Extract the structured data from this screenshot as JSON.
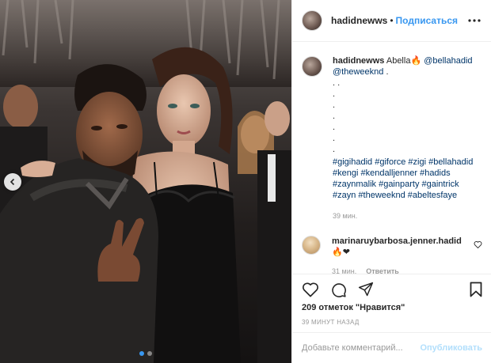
{
  "post": {
    "username": "hadidnewws",
    "separator": "•",
    "follow_label": "Подписаться",
    "caption": {
      "username": "hadidnewws",
      "text": "Abella",
      "emoji": "🔥",
      "mention_1": "@bellahadid",
      "mention_2": "@theweeknd",
      "period": ".",
      "dot_lines": [
        ". .",
        ".",
        ".",
        ".",
        ".",
        ".",
        "."
      ],
      "hashtags": "#gigihadid #giforce #zigi #bellahadid #kengi #kendalljenner #hadids #zaynmalik #gainparty #gaintrick #zayn #theweeknd #abeltesfaye",
      "time": "39 мин."
    },
    "comment": {
      "username": "marinaruybarbosa.jenner.hadid",
      "emojis": "🔥❤",
      "time": "31 мин.",
      "reply_label": "Ответить"
    },
    "likes": "209 отметок \"Нравится\"",
    "posted_ago": "39 МИНУТ НАЗАД",
    "add_comment_placeholder": "Добавьте комментарий...",
    "publish_label": "Опубликовать",
    "carousel": {
      "count": 2,
      "active_index": 0
    }
  },
  "colors": {
    "link": "#3897f0",
    "tag": "#003569",
    "muted": "#999999",
    "publish_disabled": "#b2dffc"
  },
  "icons": [
    "chevron-left-icon",
    "more-icon",
    "heart-icon",
    "comment-icon",
    "share-icon",
    "bookmark-icon"
  ]
}
